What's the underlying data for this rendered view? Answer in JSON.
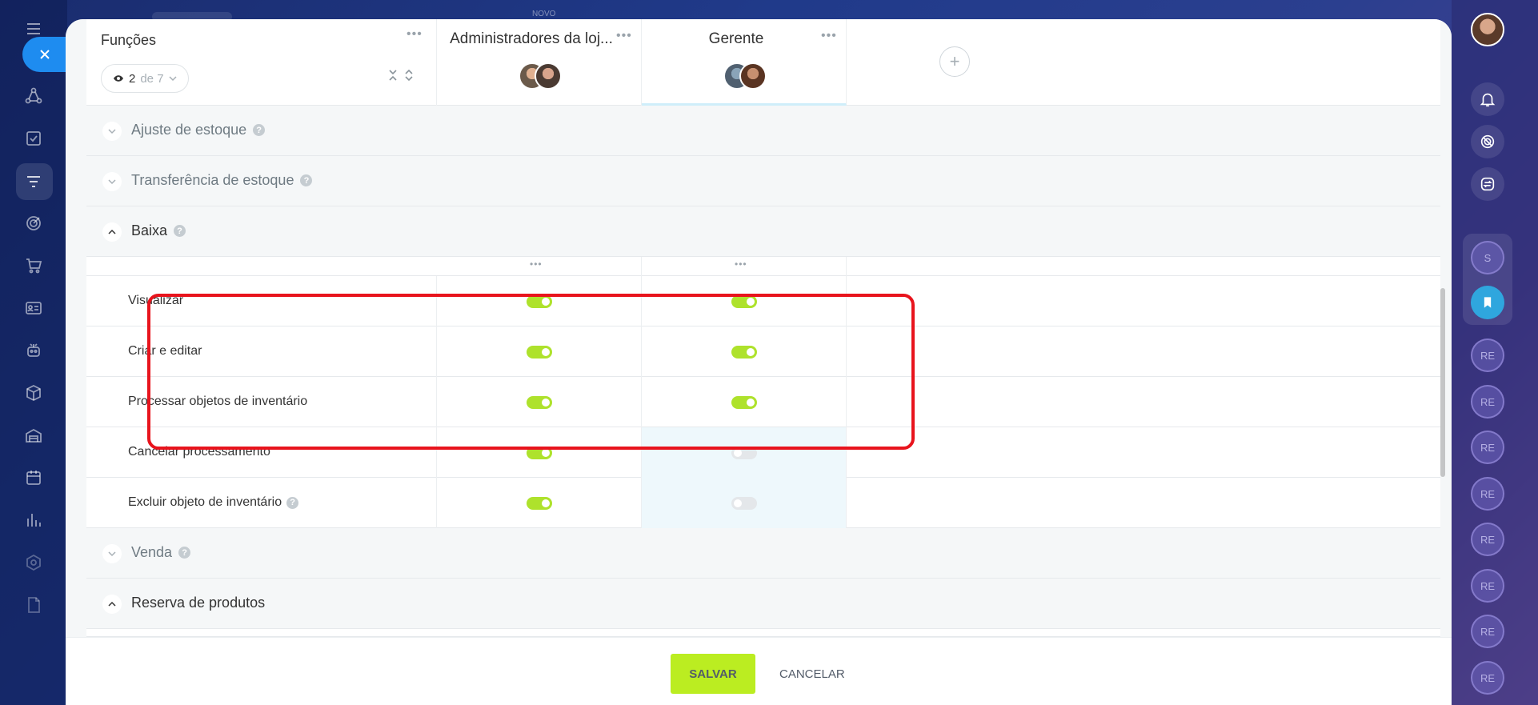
{
  "topbar": {
    "label": "NOVO"
  },
  "header": {
    "functions_title": "Funções",
    "visible_count": "2",
    "visible_total": "de 7",
    "columns": [
      {
        "title": "Administradores da loj..."
      },
      {
        "title": "Gerente"
      }
    ]
  },
  "sections": [
    {
      "label": "Ajuste de estoque",
      "expanded": false,
      "help": true
    },
    {
      "label": "Transferência de estoque",
      "expanded": false,
      "help": true
    },
    {
      "label": "Baixa",
      "expanded": true,
      "help": true
    },
    {
      "label": "Venda",
      "expanded": false,
      "help": true
    },
    {
      "label": "Reserva de produtos",
      "expanded": true,
      "help": false
    }
  ],
  "permissions": [
    {
      "label": "Visualizar",
      "admin": true,
      "gerente": true,
      "help": false
    },
    {
      "label": "Criar e editar",
      "admin": true,
      "gerente": true,
      "help": false
    },
    {
      "label": "Processar objetos de inventário",
      "admin": true,
      "gerente": true,
      "help": false
    },
    {
      "label": "Cancelar processamento",
      "admin": true,
      "gerente": false,
      "help": false
    },
    {
      "label": "Excluir objeto de inventário",
      "admin": true,
      "gerente": false,
      "help": true
    }
  ],
  "footer": {
    "save_label": "SALVAR",
    "cancel_label": "CANCELAR"
  },
  "right_sidebar": {
    "chips": [
      "S",
      "RE",
      "RE",
      "RE",
      "RE",
      "RE",
      "RE",
      "RE",
      "RE"
    ]
  },
  "colors": {
    "accent_green": "#bbed21",
    "toggle_on": "#aee22c",
    "highlight_red": "#e8141d",
    "close_blue": "#1e8cf0"
  },
  "icons": {
    "left_sidebar": [
      "menu-icon",
      "close-icon",
      "sitemap-icon",
      "task-icon",
      "funnel-icon",
      "target-icon",
      "cart-icon",
      "contact-card-icon",
      "robot-icon",
      "box-icon",
      "warehouse-icon",
      "calendar-icon",
      "chart-icon",
      "settings-icon",
      "document-icon"
    ],
    "right_sidebar": [
      "bell-icon",
      "target-icon",
      "sync-icon",
      "bookmark-icon"
    ]
  }
}
